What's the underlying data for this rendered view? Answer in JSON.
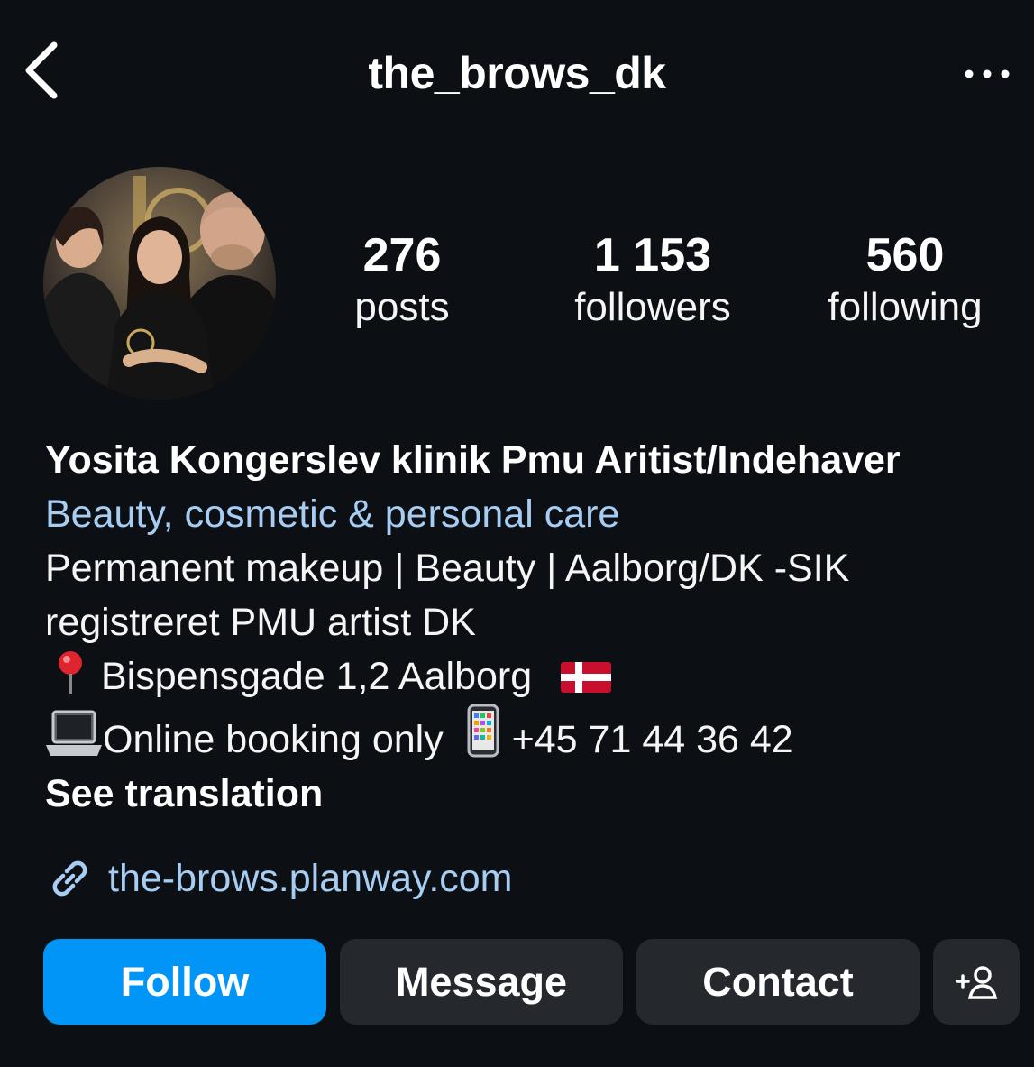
{
  "header": {
    "title": "the_brows_dk",
    "back_icon": "chevron-left-icon",
    "more_icon": "more-horizontal-icon"
  },
  "profile": {
    "avatar_icon": "profile-photo"
  },
  "stats": {
    "posts": {
      "value": "276",
      "label": "posts"
    },
    "followers": {
      "value": "1 153",
      "label": "followers"
    },
    "following": {
      "value": "560",
      "label": "following"
    }
  },
  "bio": {
    "name": "Yosita Kongerslev klinik Pmu Aritist/Indehaver",
    "category": "Beauty, cosmetic & personal care",
    "line1": "Permanent makeup | Beauty | Aalborg/DK -SIK",
    "line2": "registreret PMU artist DK",
    "address": "Bispensgade 1,2 Aalborg",
    "booking": "Online booking only",
    "phone": "+45 71 44 36 42",
    "see_translation": "See translation"
  },
  "link": {
    "url_text": "the-brows.planway.com",
    "icon": "link-icon"
  },
  "actions": {
    "follow": "Follow",
    "message": "Message",
    "contact": "Contact",
    "suggest_icon": "add-person-icon"
  },
  "colors": {
    "background": "#0c1014",
    "accent": "#0095f6",
    "link": "#a7cdf3",
    "button_secondary": "#25292e"
  }
}
